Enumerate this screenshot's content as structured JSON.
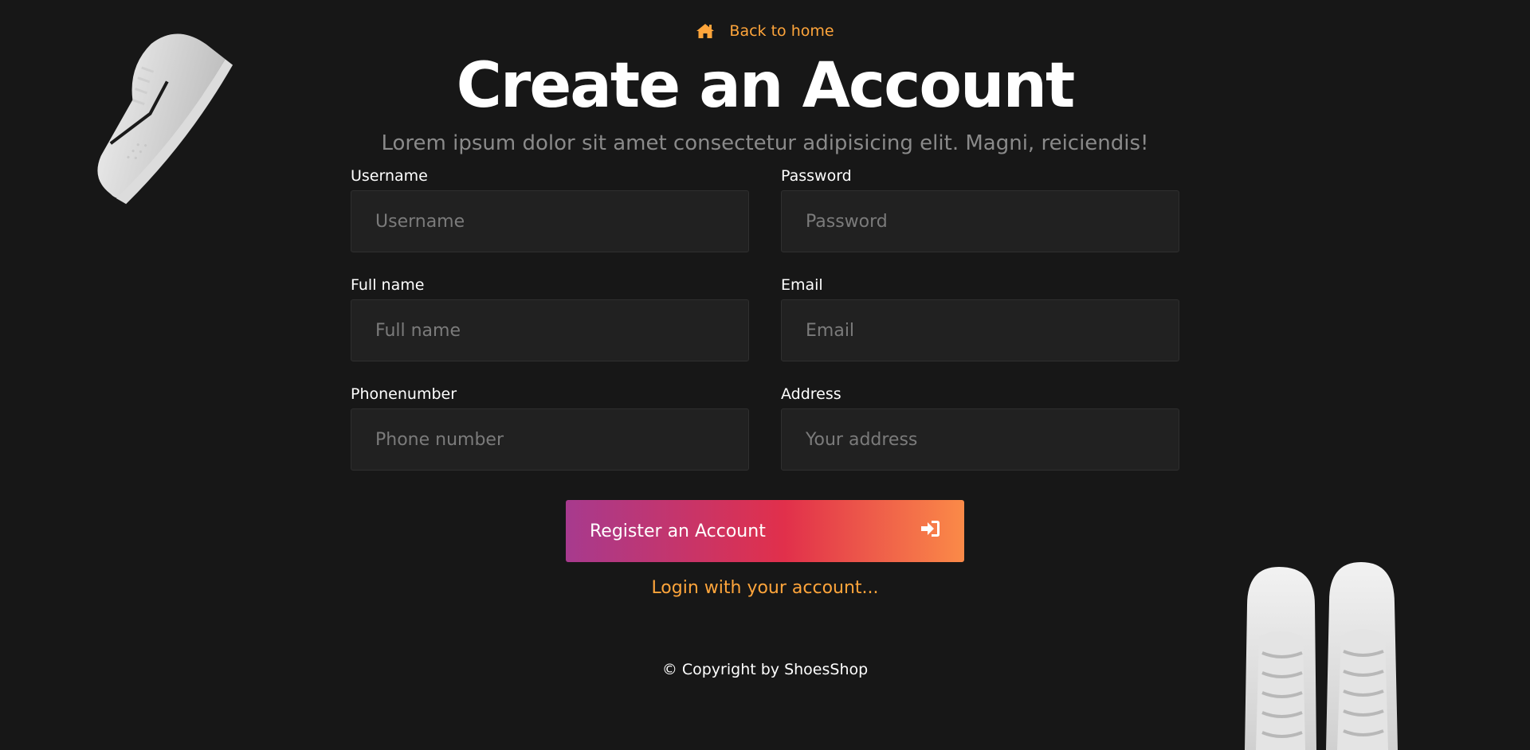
{
  "back_link": {
    "label": "Back to home",
    "icon": "home-icon"
  },
  "header": {
    "title": "Create an Account",
    "subtitle": "Lorem ipsum dolor sit amet consectetur adipisicing elit. Magni, reiciendis!"
  },
  "form": {
    "username": {
      "label": "Username",
      "placeholder": "Username",
      "value": ""
    },
    "password": {
      "label": "Password",
      "placeholder": "Password",
      "value": ""
    },
    "fullname": {
      "label": "Full name",
      "placeholder": "Full name",
      "value": ""
    },
    "email": {
      "label": "Email",
      "placeholder": "Email",
      "value": ""
    },
    "phone": {
      "label": "Phonenumber",
      "placeholder": "Phone number",
      "value": ""
    },
    "address": {
      "label": "Address",
      "placeholder": "Your address",
      "value": ""
    }
  },
  "register_button": {
    "label": "Register an Account",
    "icon": "sign-in-icon"
  },
  "login_link": "Login with your account...",
  "footer": {
    "copyright": "© Copyright by ShoesShop"
  },
  "colors": {
    "background": "#171717",
    "accent": "#ffa53b",
    "input_bg": "#212121",
    "button_gradient_start": "#a73a8e",
    "button_gradient_mid": "#e1304b",
    "button_gradient_end": "#fb8a48"
  },
  "decorations": [
    "sneaker-side-image",
    "sneakers-top-image"
  ]
}
